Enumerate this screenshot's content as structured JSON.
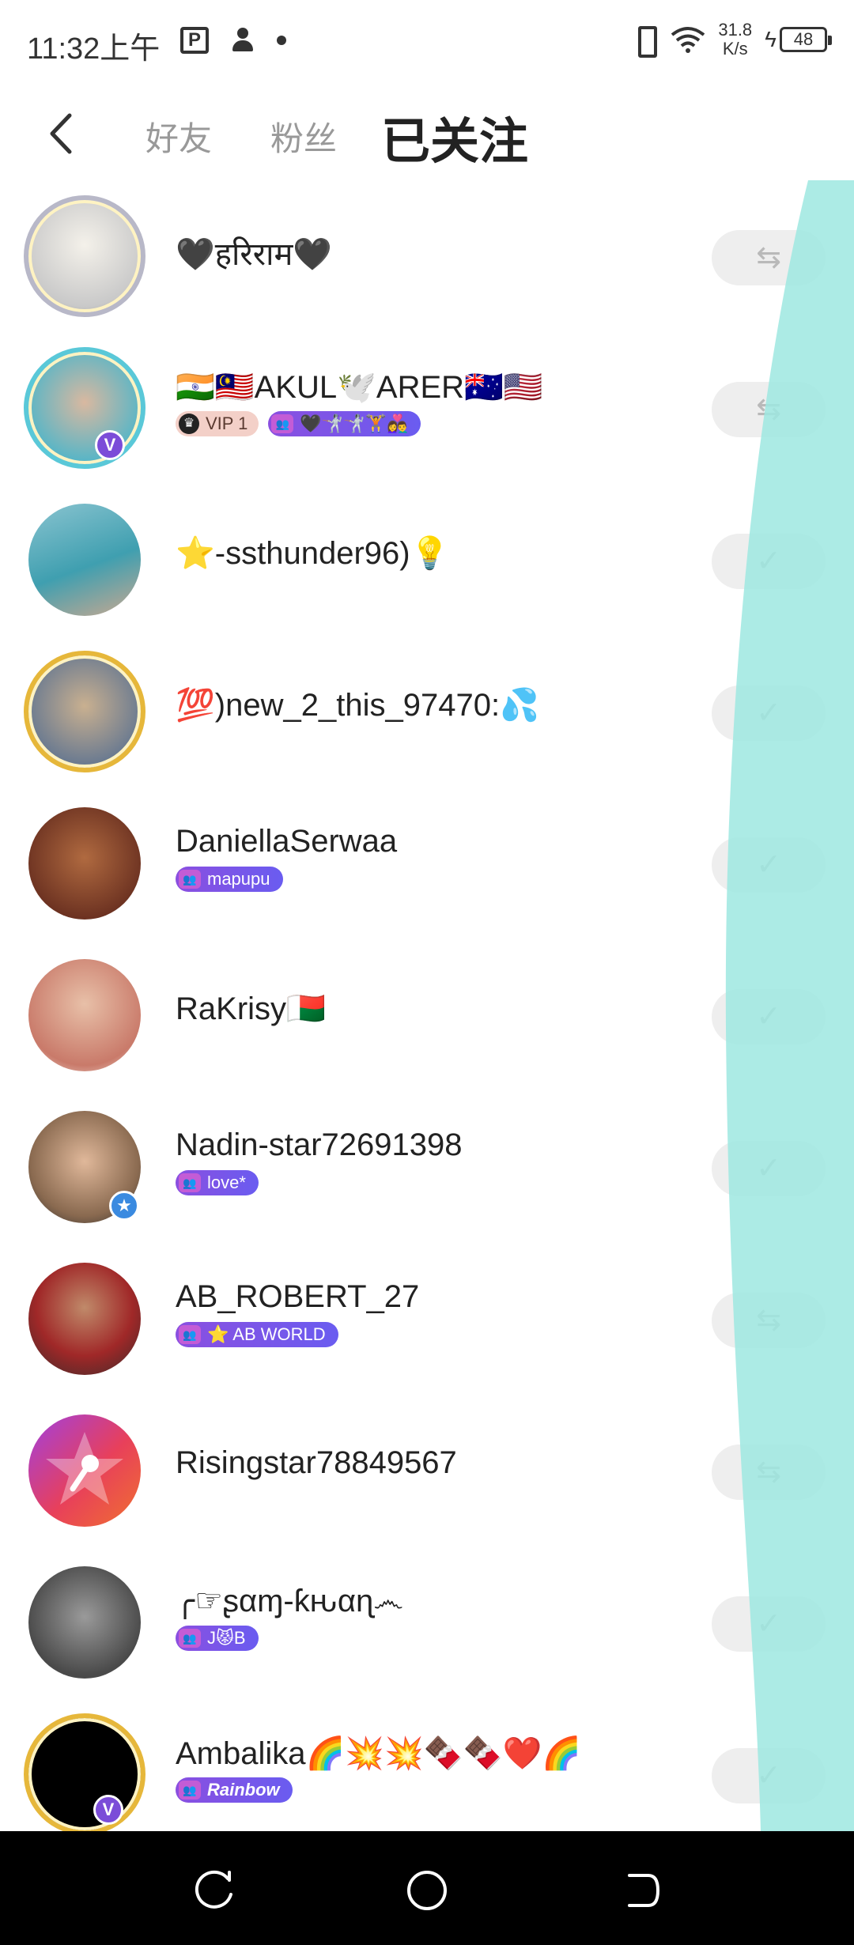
{
  "status_bar": {
    "time": "11:32上午",
    "app_icon_label": "P",
    "network_speed_value": "31.8",
    "network_speed_unit": "K/s",
    "battery": "48"
  },
  "header": {
    "tabs": [
      {
        "label": "好友",
        "active": false
      },
      {
        "label": "粉丝",
        "active": false
      },
      {
        "label": "已关注",
        "active": true
      }
    ]
  },
  "following": [
    {
      "name": "🖤हरिराम🖤",
      "badges": [],
      "button": "⇆",
      "avatar_color": "#c9c9c9",
      "frame": true
    },
    {
      "name": "🇮🇳🇲🇾AKUL🕊️ARER🇦🇺🇺🇸",
      "vip": "VIP 1",
      "badges": [
        "🖤🤺🤺🏋️👩‍❤️‍👨"
      ],
      "button": "⇆",
      "avatar_color": "#4fb5c9",
      "frame": true,
      "verified": "V"
    },
    {
      "name": "⭐-ssthunder96)💡",
      "badges": [],
      "button": "✓",
      "avatar_color": "#5fa9b8"
    },
    {
      "name": "💯)new_2_this_97470:💦",
      "badges": [],
      "button": "✓",
      "avatar_color": "#7a8aa0",
      "frame": true
    },
    {
      "name": "DaniellaSerwaa",
      "badges": [
        "mapupu"
      ],
      "button": "✓",
      "avatar_color": "#8a4a30"
    },
    {
      "name": "RaKrisy🇲🇬",
      "badges": [],
      "button": "✓",
      "avatar_color": "#d9a89a"
    },
    {
      "name": "Nadin-star72691398",
      "badges": [
        "love*"
      ],
      "button": "✓",
      "avatar_color": "#a98a70"
    },
    {
      "name": "AB_ROBERT_27",
      "badges": [
        "⭐ AB WORLD"
      ],
      "button": "⇆",
      "avatar_color": "#6a4a3a"
    },
    {
      "name": "Risingstar78849567",
      "badges": [],
      "button": "⇆",
      "avatar_color": "#e8405a"
    },
    {
      "name": "╭☞ʂαɱ-ƙԋαɳ෴",
      "badges": [
        "J😾B"
      ],
      "button": "✓",
      "avatar_color": "#6a6a6a"
    },
    {
      "name": "Ambalika🌈💥💥🍫🍫❤️🌈",
      "badges": [
        "Rainbow"
      ],
      "button": "✓",
      "avatar_color": "#000000",
      "frame": true,
      "verified": "V"
    }
  ],
  "colors": {
    "accent_mint": "#9de8e0",
    "badge_purple": "#7b4cd8",
    "button_bg": "#eeeeee"
  }
}
